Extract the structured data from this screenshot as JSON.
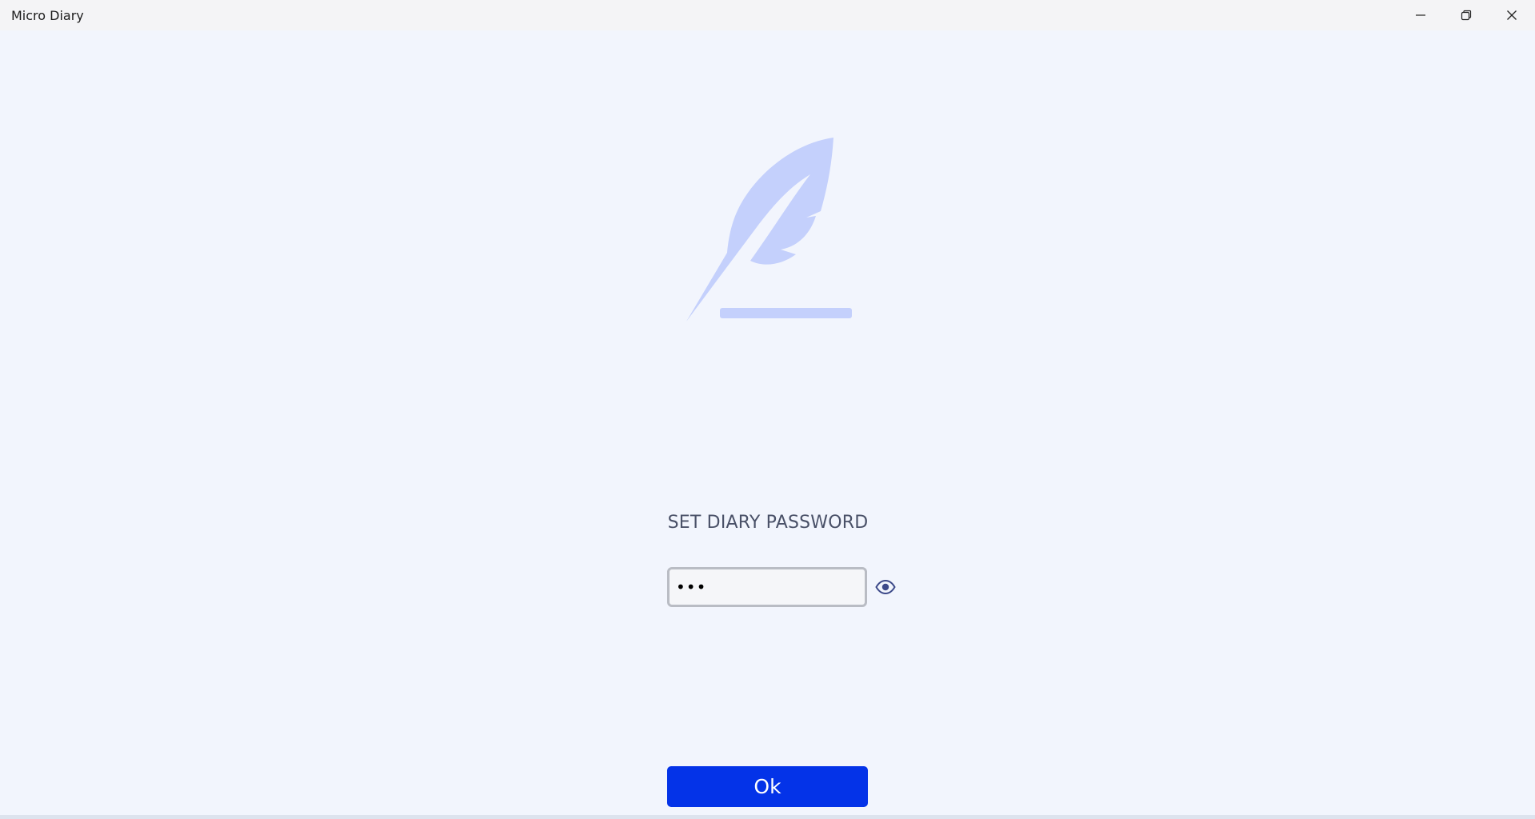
{
  "window": {
    "title": "Micro Diary",
    "controls": [
      "minimize",
      "restore",
      "close"
    ]
  },
  "logo": {
    "icon": "feather-pen-icon",
    "color": "#c4d0fc"
  },
  "form": {
    "heading": "SET DIARY PASSWORD",
    "password": {
      "value": "abc",
      "masked": true,
      "reveal_icon": "eye-icon"
    },
    "ok_label": "Ok"
  },
  "colors": {
    "background": "#f2f5fd",
    "accent": "#0433e8",
    "logo": "#c4d0fc",
    "heading": "#4a5168"
  }
}
